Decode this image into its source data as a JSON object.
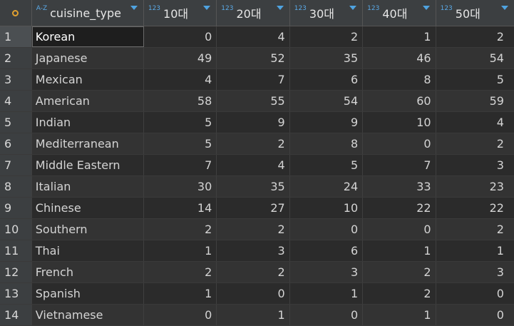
{
  "header": {
    "row_marker_icon": "circle-icon",
    "columns": [
      {
        "tag": "A-Z",
        "name": "cuisine_type"
      },
      {
        "tag": "123",
        "name": "10대"
      },
      {
        "tag": "123",
        "name": "20대"
      },
      {
        "tag": "123",
        "name": "30대"
      },
      {
        "tag": "123",
        "name": "40대"
      },
      {
        "tag": "123",
        "name": "50대"
      }
    ]
  },
  "rows": [
    {
      "n": "1",
      "type": "Korean",
      "v": [
        "0",
        "4",
        "2",
        "1",
        "2"
      ]
    },
    {
      "n": "2",
      "type": "Japanese",
      "v": [
        "49",
        "52",
        "35",
        "46",
        "54"
      ]
    },
    {
      "n": "3",
      "type": "Mexican",
      "v": [
        "4",
        "7",
        "6",
        "8",
        "5"
      ]
    },
    {
      "n": "4",
      "type": "American",
      "v": [
        "58",
        "55",
        "54",
        "60",
        "59"
      ]
    },
    {
      "n": "5",
      "type": "Indian",
      "v": [
        "5",
        "9",
        "9",
        "10",
        "4"
      ]
    },
    {
      "n": "6",
      "type": "Mediterranean",
      "v": [
        "5",
        "2",
        "8",
        "0",
        "2"
      ]
    },
    {
      "n": "7",
      "type": "Middle Eastern",
      "v": [
        "7",
        "4",
        "5",
        "7",
        "3"
      ]
    },
    {
      "n": "8",
      "type": "Italian",
      "v": [
        "30",
        "35",
        "24",
        "33",
        "23"
      ]
    },
    {
      "n": "9",
      "type": "Chinese",
      "v": [
        "14",
        "27",
        "10",
        "22",
        "22"
      ]
    },
    {
      "n": "10",
      "type": "Southern",
      "v": [
        "2",
        "2",
        "0",
        "0",
        "2"
      ]
    },
    {
      "n": "11",
      "type": "Thai",
      "v": [
        "1",
        "3",
        "6",
        "1",
        "1"
      ]
    },
    {
      "n": "12",
      "type": "French",
      "v": [
        "2",
        "2",
        "3",
        "2",
        "3"
      ]
    },
    {
      "n": "13",
      "type": "Spanish",
      "v": [
        "1",
        "0",
        "1",
        "2",
        "0"
      ]
    },
    {
      "n": "14",
      "type": "Vietnamese",
      "v": [
        "0",
        "1",
        "0",
        "1",
        "0"
      ]
    }
  ]
}
